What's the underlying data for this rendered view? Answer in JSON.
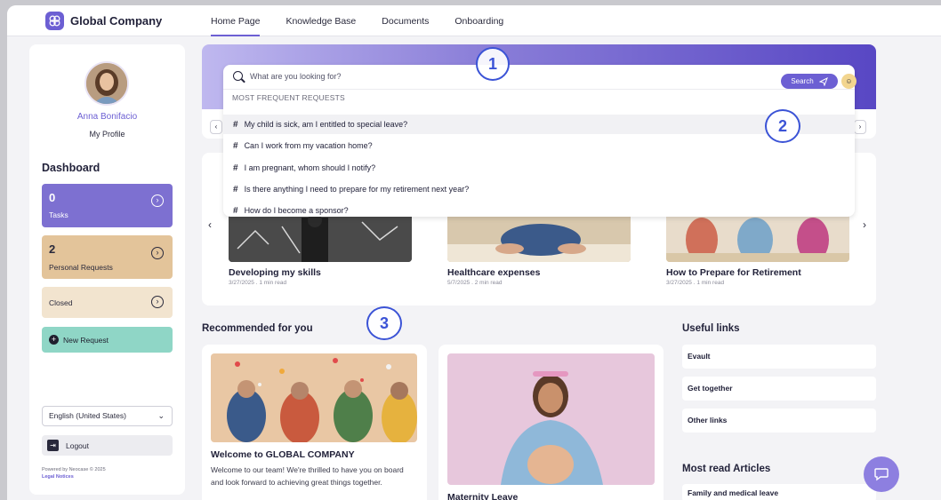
{
  "header": {
    "brand": "Global Company",
    "nav": [
      "Home Page",
      "Knowledge Base",
      "Documents",
      "Onboarding"
    ]
  },
  "sidebar": {
    "user_name": "Anna Bonifacio",
    "profile_label": "My Profile",
    "dashboard_title": "Dashboard",
    "tasks": {
      "count": "0",
      "label": "Tasks"
    },
    "personal_requests": {
      "count": "2",
      "label": "Personal Requests"
    },
    "closed": {
      "label": "Closed"
    },
    "new_request_label": "New Request",
    "language": "English (United States)",
    "logout_label": "Logout",
    "powered_by": "Powered by Neocase © 2025",
    "legal_notices": "Legal Notices"
  },
  "search": {
    "placeholder": "What are you looking for?",
    "button_label": "Search",
    "frequent_title": "MOST FREQUENT REQUESTS",
    "requests": [
      "My child is sick, am I entitled to special leave?",
      "Can I work from my vacation home?",
      "I am pregnant, whom should I notify?",
      "Is there anything I need to prepare for my retirement next year?",
      "How do I become a sponsor?"
    ]
  },
  "articles": [
    {
      "title": "Developing my skills",
      "date": "3/27/2025",
      "read": "1 min read"
    },
    {
      "title": "Healthcare expenses",
      "date": "5/7/2025",
      "read": "2 min read"
    },
    {
      "title": "How to Prepare for Retirement",
      "date": "3/27/2025",
      "read": "1 min read"
    }
  ],
  "recommended": {
    "title": "Recommended for you",
    "cards": [
      {
        "title": "Welcome to GLOBAL COMPANY",
        "body": "Welcome to our team! We're thrilled to have you on board and look forward to achieving great things together."
      },
      {
        "title": "Maternity Leave",
        "body": ""
      }
    ]
  },
  "useful_links": {
    "title": "Useful links",
    "items": [
      "Evault",
      "Get together",
      "Other links"
    ]
  },
  "most_read": {
    "title": "Most read Articles",
    "items": [
      "Family and medical leave"
    ]
  },
  "annotations": [
    "1",
    "2",
    "3"
  ],
  "colors": {
    "accent": "#6c5fd3",
    "tasks": "#7d70d1",
    "personal": "#e3c49a",
    "closed": "#f2e4cf",
    "new_request": "#8fd6c6",
    "marker": "#3b53d6"
  }
}
